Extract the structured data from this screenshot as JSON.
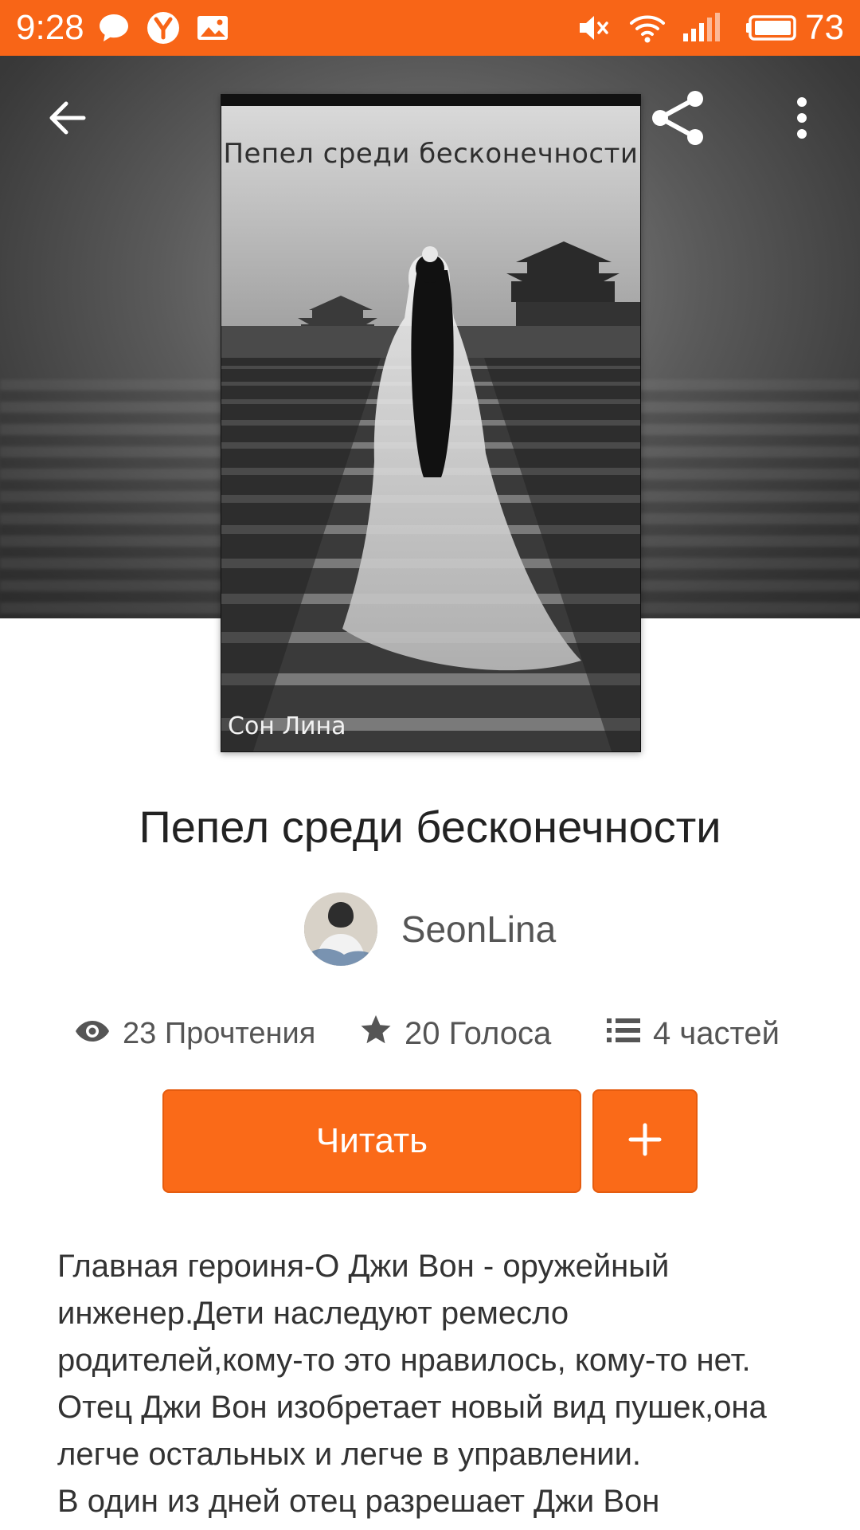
{
  "status_bar": {
    "time": "9:28",
    "battery": "73",
    "icons": [
      "chat-bubble-icon",
      "yandex-icon",
      "image-notification-icon",
      "mute-icon",
      "wifi-icon",
      "signal-icon",
      "battery-icon"
    ]
  },
  "toolbar": {
    "back_icon": "arrow-left-icon",
    "share_icon": "share-icon",
    "more_icon": "more-vertical-icon"
  },
  "cover": {
    "title_text": "Пепел среди бесконечности",
    "author_text": "Сон Лина"
  },
  "book": {
    "title": "Пепел среди бесконечности",
    "author": "SeonLina"
  },
  "stats": {
    "reads": "23 Прочтения",
    "votes": "20 Голоса",
    "parts": "4 частей"
  },
  "actions": {
    "read_label": "Читать",
    "add_label": "+"
  },
  "description": {
    "lines": [
      "Главная героиня-О Джи Вон - оружейный",
      "инженер.Дети наследуют ремесло",
      "родителей,кому-то это нравилось, кому-то нет.",
      "Отец Джи Вон изобретает новый вид пушек,она",
      "легче остальных и легче в управлении.",
      "В один из дней отец разрешает Джи Вон"
    ]
  },
  "colors": {
    "accent": "#f86517",
    "button": "#fa6a18",
    "text_primary": "#222222",
    "text_secondary": "#555555"
  }
}
